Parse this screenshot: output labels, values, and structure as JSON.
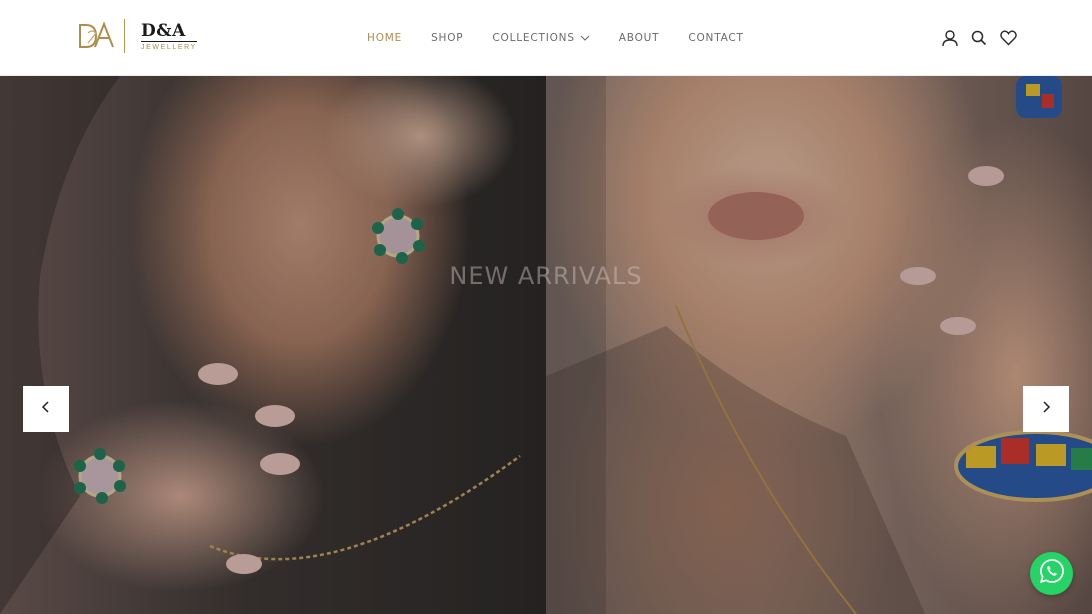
{
  "brand": {
    "monogram": "D&A",
    "name": "D&A",
    "tagline": "JEWELLERY",
    "gold": "#b08d4e"
  },
  "nav": {
    "items": [
      {
        "label": "HOME",
        "active": true
      },
      {
        "label": "SHOP",
        "active": false
      },
      {
        "label": "COLLECTIONS",
        "active": false,
        "has_dropdown": true
      },
      {
        "label": "ABOUT",
        "active": false
      },
      {
        "label": "CONTACT",
        "active": false
      }
    ]
  },
  "header_icons": [
    "account-icon",
    "search-icon",
    "wishlist-heart-icon"
  ],
  "hero": {
    "title": "NEW ARRIVALS",
    "prev_icon": "chevron-left-icon",
    "next_icon": "chevron-right-icon"
  },
  "floating": {
    "whatsapp_icon": "whatsapp-icon",
    "whatsapp_color": "#25d366"
  }
}
